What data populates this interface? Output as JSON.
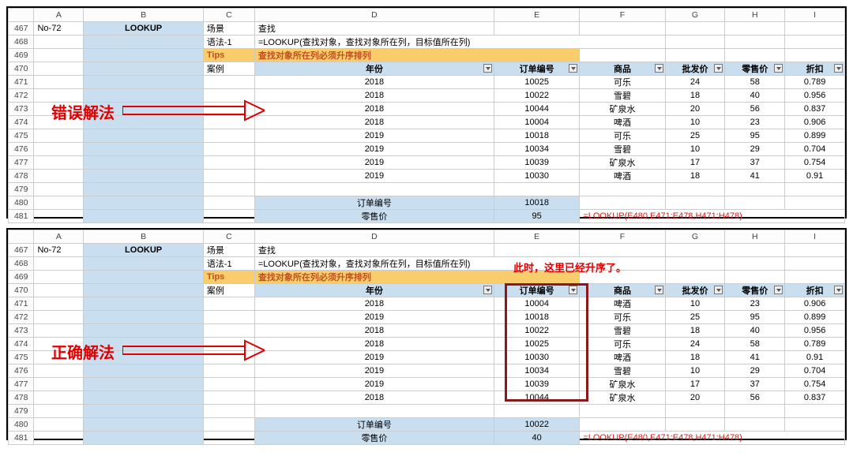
{
  "columns": [
    "A",
    "B",
    "C",
    "D",
    "E",
    "F",
    "G",
    "H",
    "I"
  ],
  "top": {
    "row_start": 467,
    "annot_label": "错误解法",
    "no": "No-72",
    "func": "LOOKUP",
    "r467": {
      "c": "场景",
      "d": "查找"
    },
    "r468": {
      "c": "语法-1",
      "d": "=LOOKUP(查找对象，查找对象所在列，目标值所在列)"
    },
    "r469": {
      "c": "Tips",
      "d": "查找对象所在列必须升序排列"
    },
    "r470": {
      "c": "案例"
    },
    "headers": {
      "d": "年份",
      "e": "订单编号",
      "f": "商品",
      "g": "批发价",
      "h": "零售价",
      "i": "折扣"
    },
    "rows": [
      {
        "d": "2018",
        "e": "10025",
        "f": "可乐",
        "g": "24",
        "h": "58",
        "i": "0.789"
      },
      {
        "d": "2018",
        "e": "10022",
        "f": "雪碧",
        "g": "18",
        "h": "40",
        "i": "0.956"
      },
      {
        "d": "2018",
        "e": "10044",
        "f": "矿泉水",
        "g": "20",
        "h": "56",
        "i": "0.837"
      },
      {
        "d": "2018",
        "e": "10004",
        "f": "啤酒",
        "g": "10",
        "h": "23",
        "i": "0.906"
      },
      {
        "d": "2019",
        "e": "10018",
        "f": "可乐",
        "g": "25",
        "h": "95",
        "i": "0.899"
      },
      {
        "d": "2019",
        "e": "10034",
        "f": "雪碧",
        "g": "10",
        "h": "29",
        "i": "0.704"
      },
      {
        "d": "2019",
        "e": "10039",
        "f": "矿泉水",
        "g": "17",
        "h": "37",
        "i": "0.754"
      },
      {
        "d": "2019",
        "e": "10030",
        "f": "啤酒",
        "g": "18",
        "h": "41",
        "i": "0.91"
      }
    ],
    "result": {
      "label1": "订单编号",
      "val1": "10018",
      "label2": "零售价",
      "val2": "95",
      "formula": "=LOOKUP(E480,E471:E478,H471:H478)"
    }
  },
  "bottom": {
    "row_start": 467,
    "annot_label": "正确解法",
    "annot_note": "此时，这里已经升序了。",
    "no": "No-72",
    "func": "LOOKUP",
    "r467": {
      "c": "场景",
      "d": "查找"
    },
    "r468": {
      "c": "语法-1",
      "d": "=LOOKUP(查找对象，查找对象所在列，目标值所在列)"
    },
    "r469": {
      "c": "Tips",
      "d": "查找对象所在列必须升序排列"
    },
    "r470": {
      "c": "案例"
    },
    "headers": {
      "d": "年份",
      "e": "订单编号",
      "f": "商品",
      "g": "批发价",
      "h": "零售价",
      "i": "折扣"
    },
    "rows": [
      {
        "d": "2018",
        "e": "10004",
        "f": "啤酒",
        "g": "10",
        "h": "23",
        "i": "0.906"
      },
      {
        "d": "2019",
        "e": "10018",
        "f": "可乐",
        "g": "25",
        "h": "95",
        "i": "0.899"
      },
      {
        "d": "2018",
        "e": "10022",
        "f": "雪碧",
        "g": "18",
        "h": "40",
        "i": "0.956"
      },
      {
        "d": "2018",
        "e": "10025",
        "f": "可乐",
        "g": "24",
        "h": "58",
        "i": "0.789"
      },
      {
        "d": "2019",
        "e": "10030",
        "f": "啤酒",
        "g": "18",
        "h": "41",
        "i": "0.91"
      },
      {
        "d": "2019",
        "e": "10034",
        "f": "雪碧",
        "g": "10",
        "h": "29",
        "i": "0.704"
      },
      {
        "d": "2019",
        "e": "10039",
        "f": "矿泉水",
        "g": "17",
        "h": "37",
        "i": "0.754"
      },
      {
        "d": "2018",
        "e": "10044",
        "f": "矿泉水",
        "g": "20",
        "h": "56",
        "i": "0.837"
      }
    ],
    "result": {
      "label1": "订单编号",
      "val1": "10022",
      "label2": "零售价",
      "val2": "40",
      "formula": "=LOOKUP(E480,E471:E478,H471:H478)"
    }
  }
}
